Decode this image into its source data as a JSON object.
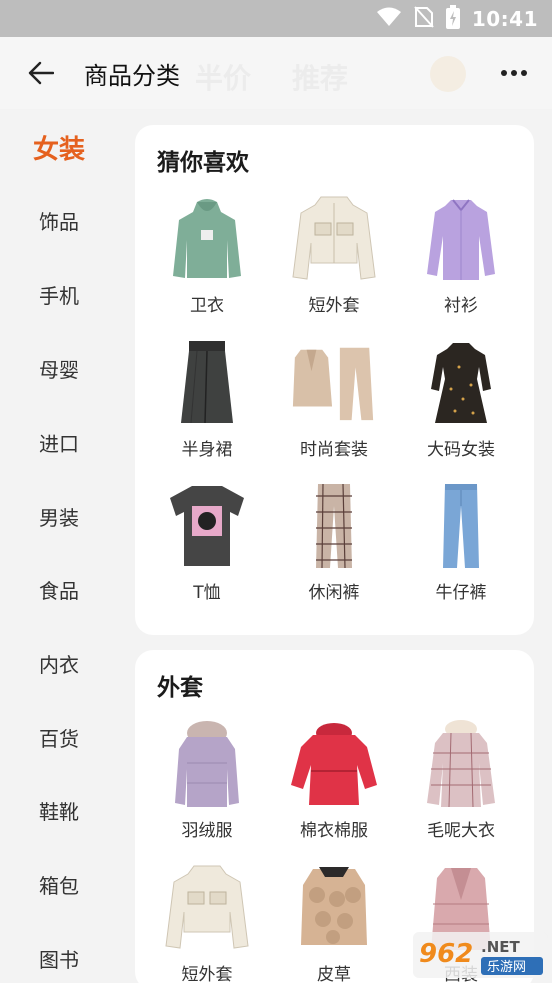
{
  "status_bar": {
    "time": "10:41"
  },
  "header": {
    "title": "商品分类",
    "ghost_left": "半价",
    "ghost_mid": "推荐"
  },
  "sidebar": {
    "items": [
      {
        "label": "女装",
        "active": true
      },
      {
        "label": "饰品"
      },
      {
        "label": "手机"
      },
      {
        "label": "母婴"
      },
      {
        "label": "进口"
      },
      {
        "label": "男装"
      },
      {
        "label": "食品"
      },
      {
        "label": "内衣"
      },
      {
        "label": "百货"
      },
      {
        "label": "鞋靴"
      },
      {
        "label": "箱包"
      },
      {
        "label": "图书"
      }
    ]
  },
  "sections": [
    {
      "title": "猜你喜欢",
      "items": [
        {
          "label": "卫衣",
          "icon": "hoodie-image"
        },
        {
          "label": "短外套",
          "icon": "short-jacket-image"
        },
        {
          "label": "衬衫",
          "icon": "shirt-image"
        },
        {
          "label": "半身裙",
          "icon": "skirt-image"
        },
        {
          "label": "时尚套装",
          "icon": "suit-image"
        },
        {
          "label": "大码女装",
          "icon": "dress-image"
        },
        {
          "label": "T恤",
          "icon": "tshirt-image"
        },
        {
          "label": "休闲裤",
          "icon": "plaid-pants-image"
        },
        {
          "label": "牛仔裤",
          "icon": "jeans-image"
        }
      ]
    },
    {
      "title": "外套",
      "items": [
        {
          "label": "羽绒服",
          "icon": "down-jacket-image"
        },
        {
          "label": "棉衣棉服",
          "icon": "cotton-coat-image"
        },
        {
          "label": "毛呢大衣",
          "icon": "wool-coat-image"
        },
        {
          "label": "短外套",
          "icon": "short-jacket-image"
        },
        {
          "label": "皮草",
          "icon": "fur-coat-image"
        },
        {
          "label": "西装",
          "icon": "blazer-image"
        }
      ]
    }
  ],
  "watermark": {
    "text": "962.NET",
    "sub": "乐游网"
  },
  "colors": {
    "accent": "#e5611e",
    "background": "#f3f3f3",
    "card": "#ffffff"
  }
}
